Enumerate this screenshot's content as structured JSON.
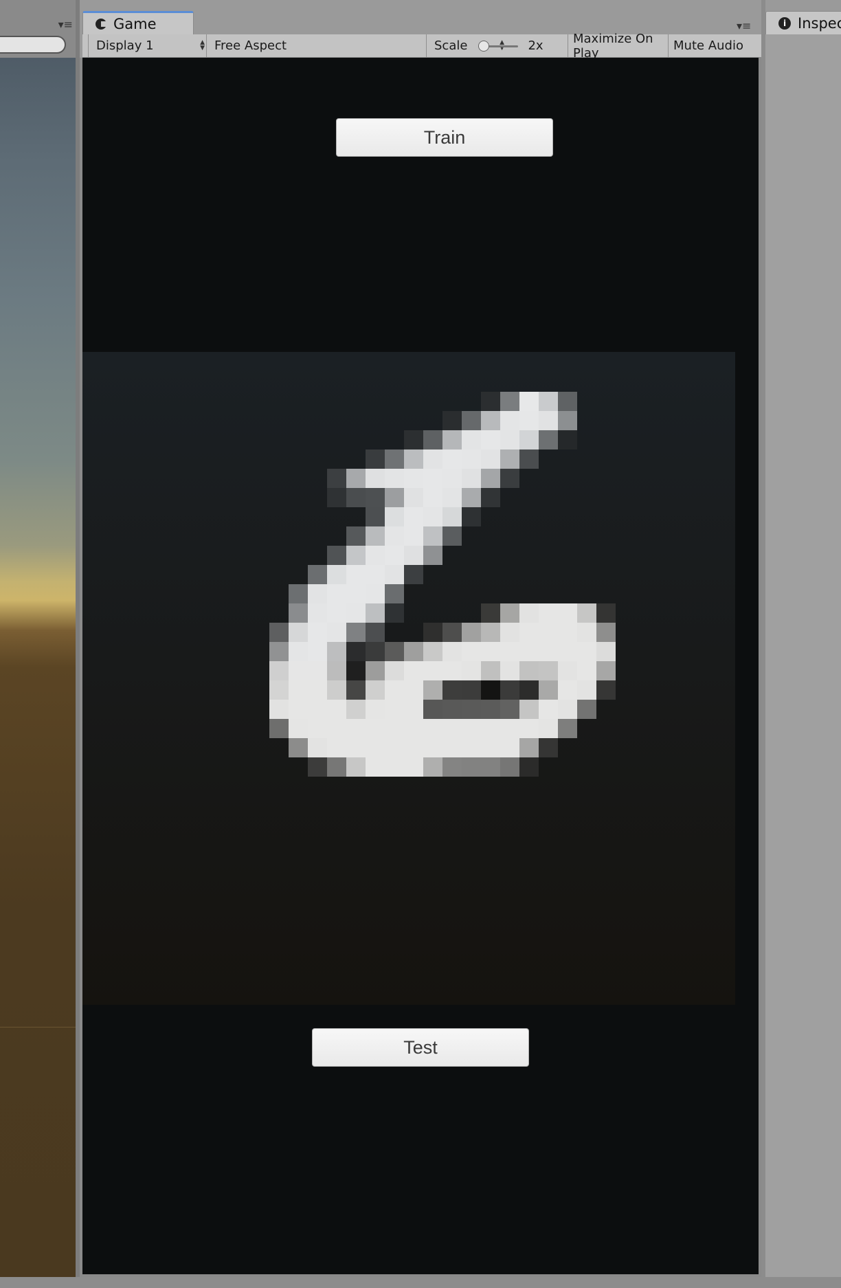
{
  "scene": {
    "menu_icon": "panel-menu-icon"
  },
  "game": {
    "tab_label": "Game",
    "tab_icon": "pacman-icon",
    "menu_icon": "panel-menu-icon",
    "toolbar": {
      "display": "Display 1",
      "aspect": "Free Aspect",
      "scale_label": "Scale",
      "scale_value": "2x",
      "scale_level": 0.0,
      "maximize": "Maximize On Play",
      "mute": "Mute Audio"
    },
    "train_label": "Train",
    "test_label": "Test",
    "digit_grid": {
      "rows": 28,
      "cols": 28,
      "description_icon": "handwritten-digit-6",
      "pixels": [
        [
          23,
          8,
          0.2
        ],
        [
          23,
          9,
          0.55
        ],
        [
          23,
          10,
          0.95
        ],
        [
          23,
          11,
          0.8
        ],
        [
          23,
          12,
          0.4
        ],
        [
          22,
          9,
          0.4
        ],
        [
          22,
          10,
          0.85
        ],
        [
          22,
          11,
          0.95
        ],
        [
          22,
          12,
          0.6
        ],
        [
          21,
          10,
          0.3
        ],
        [
          21,
          11,
          0.7
        ],
        [
          21,
          12,
          0.95
        ],
        [
          21,
          13,
          0.7
        ],
        [
          21,
          14,
          0.2
        ],
        [
          20,
          11,
          0.3
        ],
        [
          20,
          12,
          0.75
        ],
        [
          20,
          13,
          0.95
        ],
        [
          20,
          14,
          0.55
        ]
      ]
    }
  },
  "inspector": {
    "tab_label": "Inspector",
    "tab_icon": "info-icon"
  }
}
